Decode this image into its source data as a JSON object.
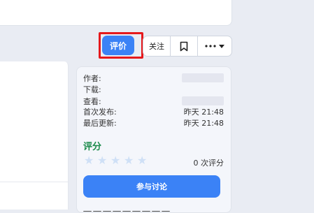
{
  "actions": {
    "rate_label": "评价",
    "follow_label": "关注",
    "bookmark_icon": "bookmark-icon",
    "more_icon": "more-dots-icon"
  },
  "info": {
    "author_label": "作者:",
    "downloads_label": "下载:",
    "views_label": "查看:",
    "first_published_label": "首次发布:",
    "first_published_value": "昨天 21:48",
    "last_updated_label": "最后更新:",
    "last_updated_value": "昨天 21:48"
  },
  "rating": {
    "title": "评分",
    "stars_filled": 0,
    "stars_total": 5,
    "count_text": "0 次评分",
    "discuss_label": "参与讨论"
  },
  "colors": {
    "accent": "#3b82f6",
    "highlight": "#e5191c",
    "rating_title": "#1a8a4a"
  }
}
